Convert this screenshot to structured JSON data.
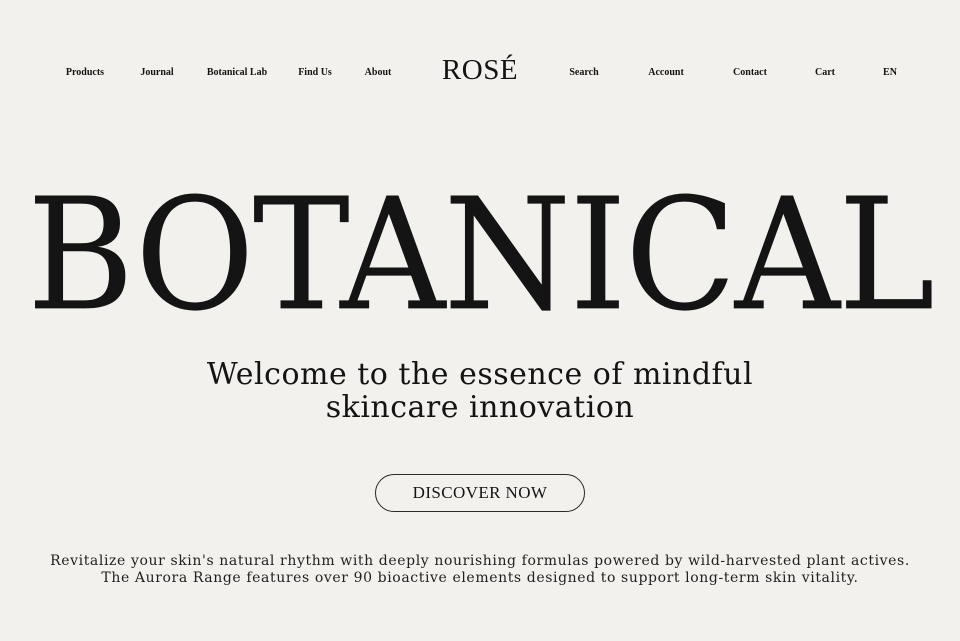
{
  "header": {
    "logo": "ROSÉ",
    "nav_left": [
      "Products",
      "Journal",
      "Botanical Lab",
      "Find Us",
      "About"
    ],
    "nav_right": [
      "Search",
      "Account",
      "Contact",
      "Cart",
      "EN"
    ]
  },
  "hero": {
    "title": "BOTANICAL",
    "subtitle_line1": "Welcome to the essence of mindful",
    "subtitle_line2": "skincare innovation",
    "cta_label": "DISCOVER NOW"
  },
  "description": {
    "line1": "Revitalize your skin's natural rhythm with deeply nourishing formulas powered by wild-harvested plant actives.",
    "line2": "The Aurora Range features over 90 bioactive elements designed to support long-term skin vitality."
  },
  "colors": {
    "background": "#f2f1ed",
    "text": "#141414"
  }
}
